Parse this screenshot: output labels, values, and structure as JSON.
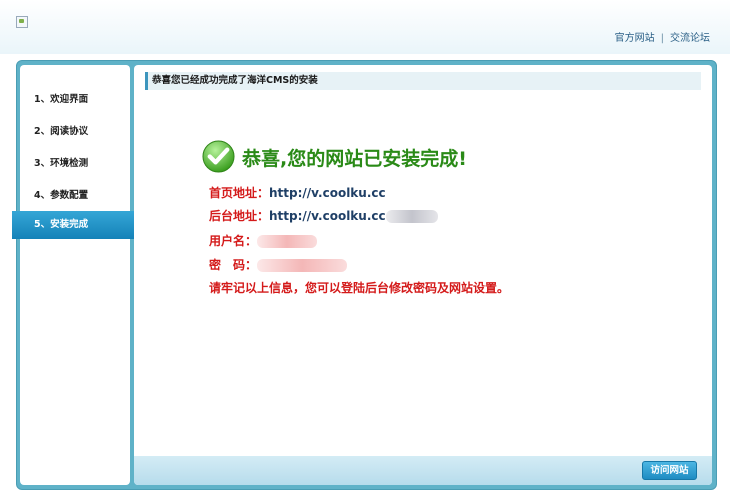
{
  "header": {
    "links": [
      "官方网站",
      "交流论坛"
    ],
    "separator": "|"
  },
  "steps": [
    {
      "label": "1、欢迎界面",
      "active": false
    },
    {
      "label": "2、阅读协议",
      "active": false
    },
    {
      "label": "3、环境检测",
      "active": false
    },
    {
      "label": "4、参数配置",
      "active": false
    },
    {
      "label": "5、安装完成",
      "active": true
    }
  ],
  "main": {
    "title": "恭喜您已经成功完成了海洋CMS的安装",
    "success_message": "恭喜,您的网站已安装完成!",
    "home_label": "首页地址：",
    "home_value": "http://v.coolku.cc",
    "admin_label": "后台地址：",
    "admin_value": "http://v.coolku.cc",
    "username_label": "用户名：",
    "password_label": "密　码：",
    "note": "请牢记以上信息，您可以登陆后台修改密码及网站设置。"
  },
  "footer": {
    "visit_label": "访问网站"
  },
  "colors": {
    "frame": "#5fb2c8",
    "active_step": "#1e8fc4",
    "success": "#2a8a17",
    "label_red": "#d41a1a",
    "value_blue": "#1f3f66"
  },
  "icons": {
    "logo": "broken-image-icon",
    "success": "check-circle-icon"
  }
}
